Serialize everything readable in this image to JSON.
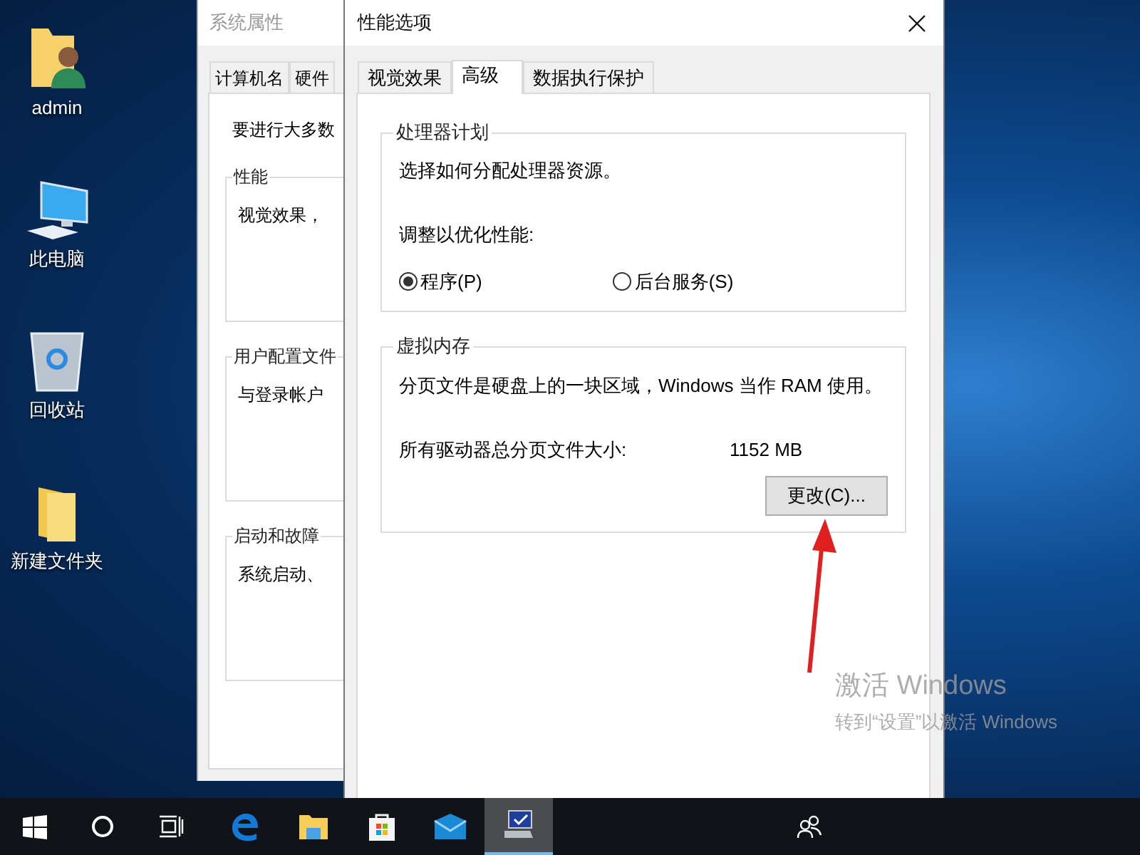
{
  "desktop_icons": [
    {
      "kind": "user-folder",
      "label": "admin"
    },
    {
      "kind": "computer",
      "label": "此电脑"
    },
    {
      "kind": "recycle-bin",
      "label": "回收站"
    },
    {
      "kind": "folder",
      "label": "新建文件夹"
    }
  ],
  "system_properties": {
    "title": "系统属性",
    "tabs": [
      {
        "label": "计算机名",
        "selected": false
      },
      {
        "label": "硬件",
        "selected": false
      }
    ],
    "intro": "要进行大多数",
    "groups": [
      {
        "title": "性能",
        "text": "视觉效果，"
      },
      {
        "title": "用户配置文件",
        "text": "与登录帐户"
      },
      {
        "title": "启动和故障",
        "text": "系统启动、"
      }
    ]
  },
  "performance_options": {
    "title": "性能选项",
    "tabs": [
      {
        "label": "视觉效果",
        "selected": false
      },
      {
        "label": "高级",
        "selected": true
      },
      {
        "label": "数据执行保护",
        "selected": false
      }
    ],
    "processor_scheduling": {
      "title": "处理器计划",
      "description": "选择如何分配处理器资源。",
      "prompt": "调整以优化性能:",
      "options": [
        {
          "label": "程序(P)",
          "selected": true
        },
        {
          "label": "后台服务(S)",
          "selected": false
        }
      ]
    },
    "virtual_memory": {
      "title": "虚拟内存",
      "description": "分页文件是硬盘上的一块区域，Windows 当作 RAM 使用。",
      "size_label": "所有驱动器总分页文件大小:",
      "size_value": "1152 MB",
      "button": "更改(C)..."
    }
  },
  "activation_notice": {
    "title": "激活 Windows",
    "subtitle": "转到“设置”以激活 Windows"
  },
  "taskbar": {
    "items": [
      {
        "kind": "start",
        "active": false
      },
      {
        "kind": "search",
        "active": false
      },
      {
        "kind": "task-view",
        "active": false
      },
      {
        "kind": "browser",
        "active": false
      },
      {
        "kind": "file-explorer",
        "active": false
      },
      {
        "kind": "store",
        "active": false
      },
      {
        "kind": "mail",
        "active": false
      },
      {
        "kind": "system-properties",
        "active": true
      }
    ]
  }
}
